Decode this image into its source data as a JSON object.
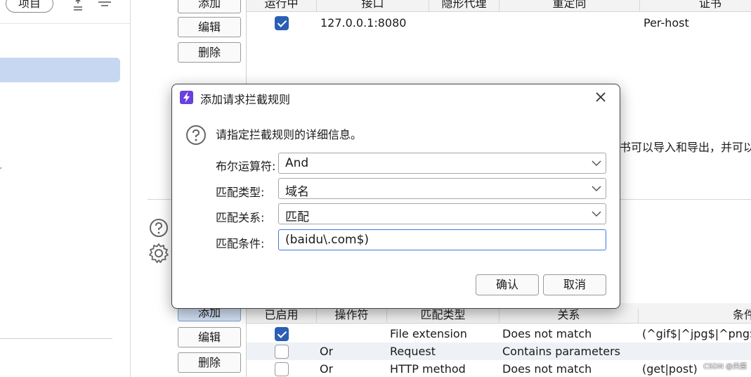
{
  "left_panel": {
    "project_button": "项目",
    "sort_icon": "sort-icon",
    "filter_icon": "filter-icon"
  },
  "proxy_buttons": {
    "add": "添加",
    "edit": "编辑",
    "delete": "删除"
  },
  "proxy_table": {
    "columns": [
      "运行中",
      "接口",
      "隐形代理",
      "重定向",
      "证书"
    ],
    "rows": [
      {
        "running": true,
        "interface": "127.0.0.1:8080",
        "invisible": "",
        "redirect": "",
        "certificate": "Per-host"
      }
    ]
  },
  "background_text": "书可以导入和导出，并可以",
  "rules_buttons": {
    "add": "添加",
    "edit": "编辑",
    "delete": "删除"
  },
  "rules_table": {
    "columns": [
      "已启用",
      "操作符",
      "匹配类型",
      "关系",
      "条件"
    ],
    "rows": [
      {
        "enabled": true,
        "operator": "",
        "match_type": "File extension",
        "relation": "Does not match",
        "condition": "(^gif$|^jpg$|^png$|"
      },
      {
        "enabled": false,
        "operator": "Or",
        "match_type": "Request",
        "relation": "Contains parameters",
        "condition": ""
      },
      {
        "enabled": false,
        "operator": "Or",
        "match_type": "HTTP method",
        "relation": "Does not match",
        "condition": "(get|post)"
      }
    ]
  },
  "dialog": {
    "title": "添加请求拦截规则",
    "info": "请指定拦截规则的详细信息。",
    "fields": [
      {
        "label": "布尔运算符:",
        "value": "And",
        "type": "select"
      },
      {
        "label": "匹配类型:",
        "value": "域名",
        "type": "select"
      },
      {
        "label": "匹配关系:",
        "value": "匹配",
        "type": "select"
      },
      {
        "label": "匹配条件:",
        "value": "(baidu\\.com$)",
        "type": "text"
      }
    ],
    "confirm": "确认",
    "cancel": "取消"
  },
  "watermark": "CSDN @关酱",
  "colors": {
    "accent": "#2b5fb4",
    "selection": "#c7d7f2",
    "app_icon": "#6b3fe0",
    "focus": "#3b7be0"
  }
}
